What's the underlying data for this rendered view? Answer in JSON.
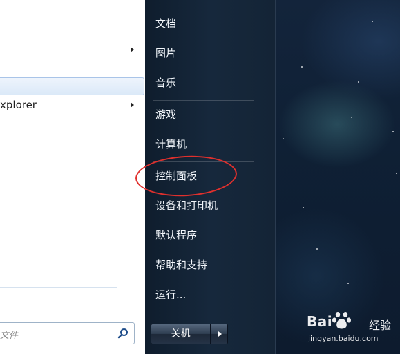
{
  "left_menu": {
    "items": [
      {
        "label": "",
        "has_arrow": true
      },
      {
        "label": "",
        "selected": true
      },
      {
        "label": "xplorer",
        "has_arrow": true
      }
    ],
    "search_placeholder": "文件"
  },
  "right_menu": {
    "items": [
      {
        "label": "文档"
      },
      {
        "label": "图片"
      },
      {
        "label": "音乐"
      },
      {
        "label": "游戏"
      },
      {
        "label": "计算机"
      },
      {
        "label": "控制面板"
      },
      {
        "label": "设备和打印机"
      },
      {
        "label": "默认程序"
      },
      {
        "label": "帮助和支持"
      },
      {
        "label": "运行..."
      }
    ],
    "shutdown_label": "关机"
  },
  "annotation": {
    "target": "控制面板",
    "color": "#e0302d"
  },
  "watermark": {
    "brand": "Bai",
    "brand_suffix": "经验",
    "url": "jingyan.baidu.com"
  },
  "colors": {
    "accent_red": "#e0302d",
    "menu_dark": "#16283c",
    "selection_blue": "#dbe9f8"
  }
}
